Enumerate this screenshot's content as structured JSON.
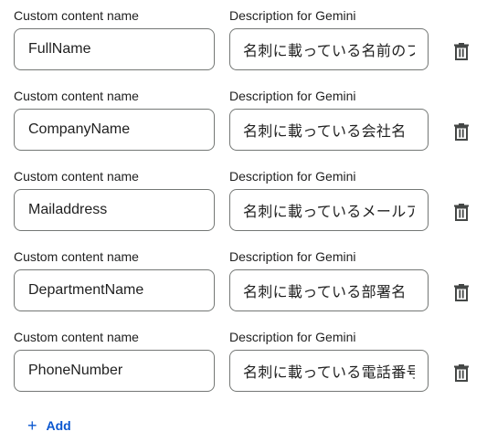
{
  "rows": [
    {
      "name_label": "Custom content name",
      "name_value": "FullName",
      "desc_label": "Description for Gemini",
      "desc_value": "名刺に載っている名前のフルネーム",
      "delete_icon": "trash-icon"
    },
    {
      "name_label": "Custom content name",
      "name_value": "CompanyName",
      "desc_label": "Description for Gemini",
      "desc_value": "名刺に載っている会社名",
      "delete_icon": "trash-icon"
    },
    {
      "name_label": "Custom content name",
      "name_value": "Mailaddress",
      "desc_label": "Description for Gemini",
      "desc_value": "名刺に載っているメールアドレス",
      "delete_icon": "trash-icon"
    },
    {
      "name_label": "Custom content name",
      "name_value": "DepartmentName",
      "desc_label": "Description for Gemini",
      "desc_value": "名刺に載っている部署名",
      "delete_icon": "trash-icon"
    },
    {
      "name_label": "Custom content name",
      "name_value": "PhoneNumber",
      "desc_label": "Description for Gemini",
      "desc_value": "名刺に載っている電話番号",
      "delete_icon": "trash-icon"
    }
  ],
  "add_button": {
    "icon": "plus-icon",
    "label": "Add"
  },
  "colors": {
    "accent": "#0b57d0",
    "text": "#1f1f1f",
    "border": "#747775",
    "icon": "#444746"
  }
}
